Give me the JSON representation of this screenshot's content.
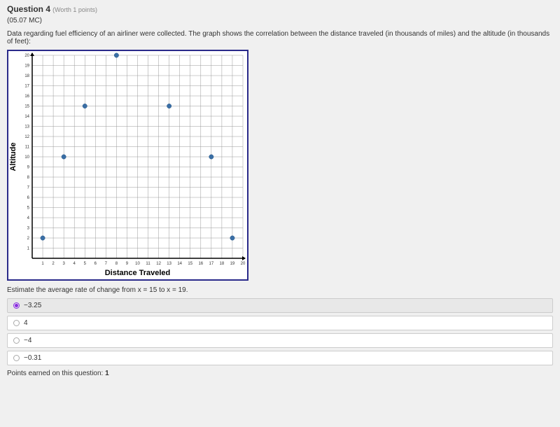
{
  "question": {
    "title": "Question 4",
    "worth": "(Worth 1 points)",
    "code": "(05.07 MC)",
    "prompt": "Data regarding fuel efficiency of an airliner were collected. The graph shows the correlation between the distance traveled (in thousands of miles) and the altitude (in thousands of feet):",
    "subprompt": "Estimate the average rate of change from x = 15 to x = 19.",
    "points_earned_label": "Points earned on this question:",
    "points_earned_value": "1"
  },
  "answers": [
    {
      "label": "−3.25",
      "selected": true
    },
    {
      "label": "4",
      "selected": false
    },
    {
      "label": "−4",
      "selected": false
    },
    {
      "label": "−0.31",
      "selected": false
    }
  ],
  "chart_data": {
    "type": "scatter",
    "title": "",
    "xlabel": "Distance Traveled",
    "ylabel": "Altitude",
    "xlim": [
      0,
      20
    ],
    "ylim": [
      0,
      20
    ],
    "xticks": [
      1,
      2,
      3,
      4,
      5,
      6,
      7,
      8,
      9,
      10,
      11,
      12,
      13,
      14,
      15,
      16,
      17,
      18,
      19,
      20
    ],
    "yticks": [
      1,
      2,
      3,
      4,
      5,
      6,
      7,
      8,
      9,
      10,
      11,
      12,
      13,
      14,
      15,
      16,
      17,
      18,
      19,
      20
    ],
    "points": [
      {
        "x": 1,
        "y": 2
      },
      {
        "x": 3,
        "y": 10
      },
      {
        "x": 5,
        "y": 15
      },
      {
        "x": 8,
        "y": 20
      },
      {
        "x": 13,
        "y": 15
      },
      {
        "x": 17,
        "y": 10
      },
      {
        "x": 19,
        "y": 2
      }
    ]
  }
}
